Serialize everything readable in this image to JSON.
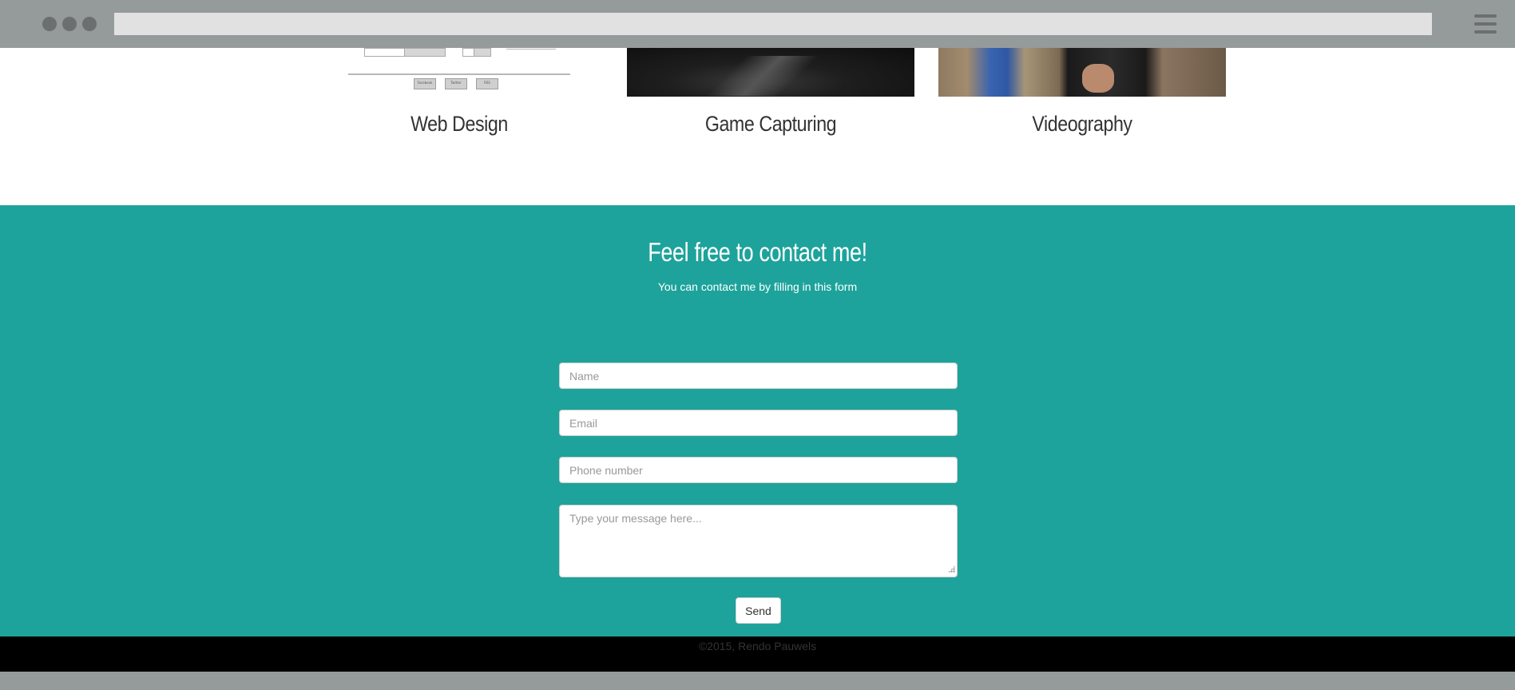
{
  "services": {
    "items": [
      {
        "title": "Web Design"
      },
      {
        "title": "Game Capturing"
      },
      {
        "title": "Videography"
      }
    ],
    "wireframe_buttons": [
      "Facebook",
      "Twitter",
      "RSS"
    ]
  },
  "contact": {
    "heading": "Feel free to contact me!",
    "subheading": "You can contact me by filling in this form",
    "name_placeholder": "Name",
    "email_placeholder": "Email",
    "phone_placeholder": "Phone number",
    "message_placeholder": "Type your message here...",
    "send_label": "Send",
    "background_color": "#1da39b"
  },
  "footer": {
    "copyright": "©2015, Rendo Pauwels"
  }
}
